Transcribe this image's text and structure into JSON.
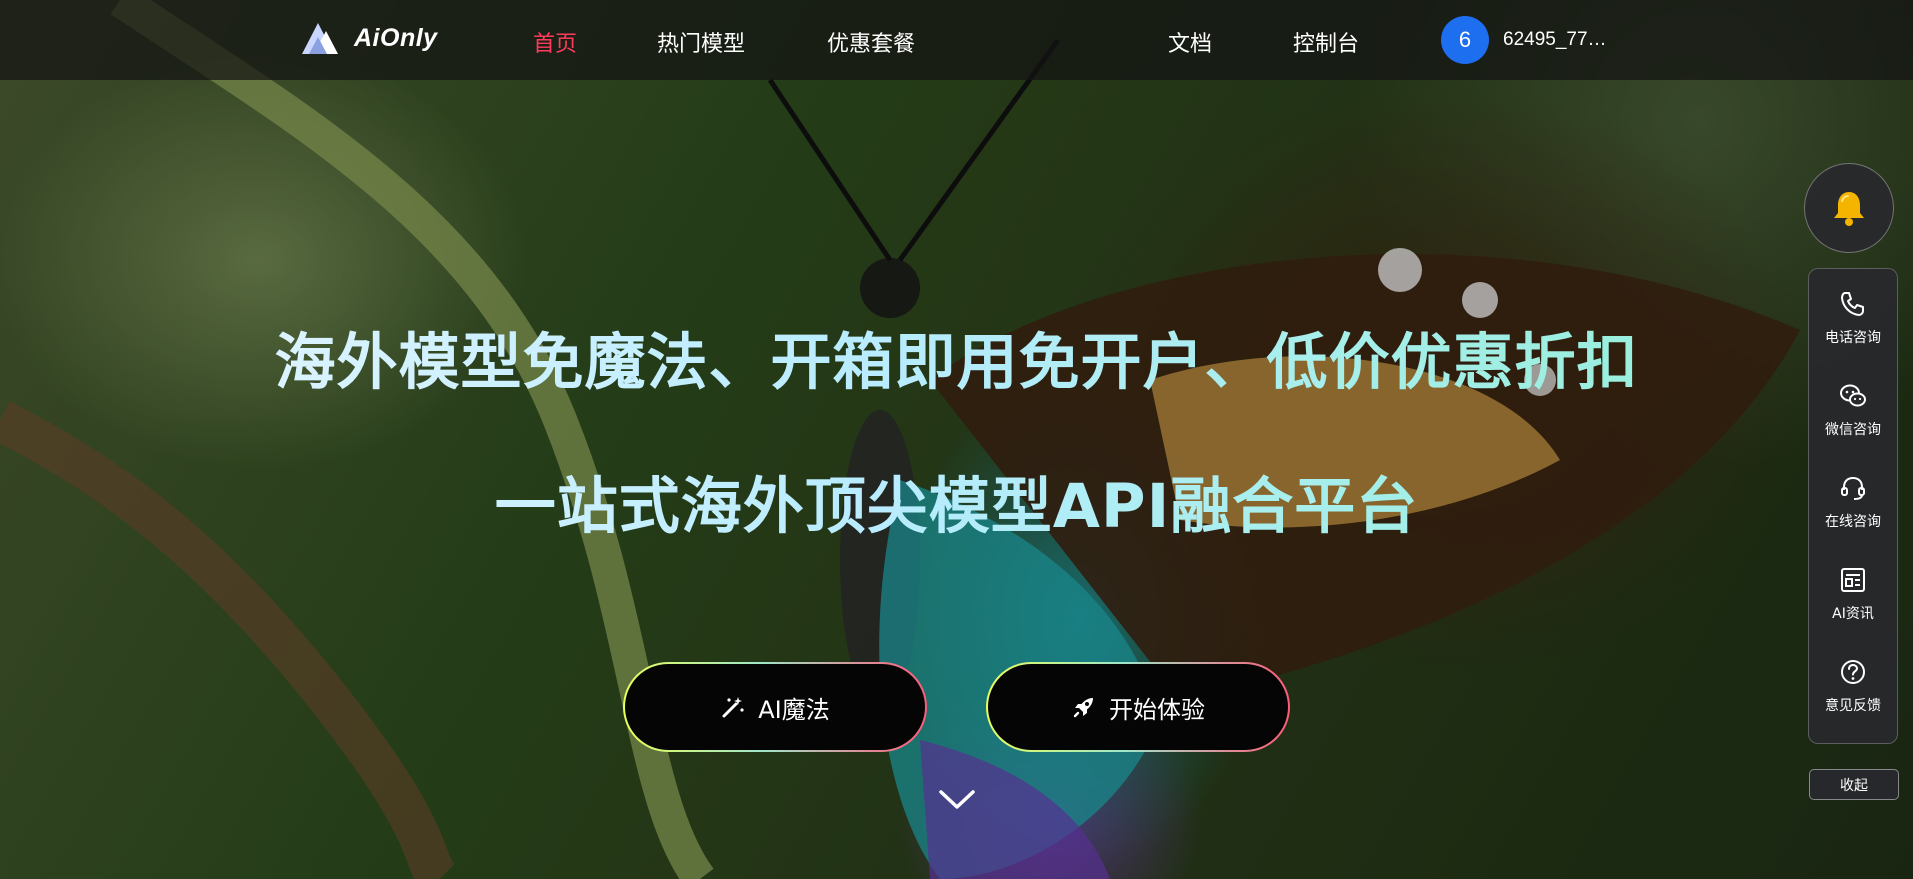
{
  "brand": {
    "name": "AiOnly"
  },
  "nav": {
    "items": [
      {
        "label": "首页",
        "active": true
      },
      {
        "label": "热门模型",
        "active": false
      },
      {
        "label": "优惠套餐",
        "active": false
      },
      {
        "label": "文档",
        "active": false
      },
      {
        "label": "控制台",
        "active": false
      }
    ]
  },
  "user": {
    "avatar_initial": "6",
    "name": "62495_77…"
  },
  "hero": {
    "headline_1": "海外模型免魔法、开箱即用免开户、低价优惠折扣",
    "headline_2": "一站式海外顶尖模型API融合平台",
    "buttons": [
      {
        "label": "AI魔法",
        "icon": "magic-wand-icon"
      },
      {
        "label": "开始体验",
        "icon": "rocket-icon"
      }
    ],
    "scroll_icon": "chevron-down-icon"
  },
  "sidebar": {
    "bell_icon": "bell-icon",
    "items": [
      {
        "label": "电话咨询",
        "icon": "phone-icon"
      },
      {
        "label": "微信咨询",
        "icon": "wechat-icon"
      },
      {
        "label": "在线咨询",
        "icon": "headset-icon"
      },
      {
        "label": "AI资讯",
        "icon": "news-icon"
      },
      {
        "label": "意见反馈",
        "icon": "help-icon"
      }
    ],
    "collapse_label": "收起"
  },
  "colors": {
    "nav_active": "#ff3b5c",
    "avatar_bg": "#1e6ef0",
    "bell": "#f5b400"
  }
}
